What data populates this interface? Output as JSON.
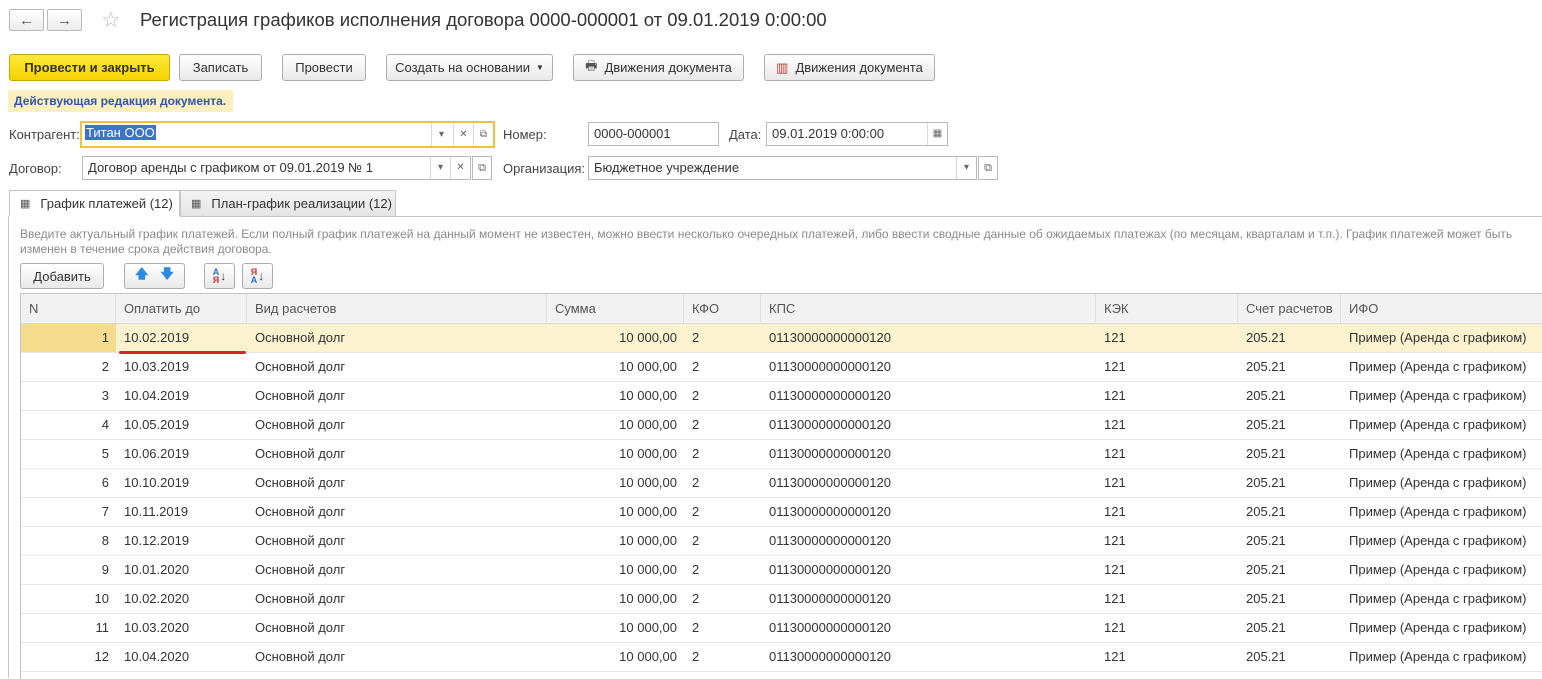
{
  "nav": {
    "back_icon": "←",
    "forward_icon": "→",
    "star_icon": "☆"
  },
  "window": {
    "title": "Регистрация графиков исполнения договора 0000-000001 от 09.01.2019 0:00:00"
  },
  "toolbar": {
    "post_close": "Провести и закрыть",
    "save": "Записать",
    "post": "Провести",
    "create_based": "Создать на основании",
    "movements_1": "Движения документа",
    "movements_2": "Движения документа"
  },
  "banner": "Действующая редакция документа.",
  "form": {
    "counterparty_label": "Контрагент:",
    "counterparty_value": "Титан ООО",
    "number_label": "Номер:",
    "number_value": "0000-000001",
    "date_label": "Дата:",
    "date_value": "09.01.2019  0:00:00",
    "contract_label": "Договор:",
    "contract_value": "Договор аренды с графиком от 09.01.2019 № 1",
    "org_label": "Организация:",
    "org_value": "Бюджетное учреждение"
  },
  "tabs": [
    {
      "label": "График платежей (12)"
    },
    {
      "label": "План-график реализации (12)"
    }
  ],
  "hint": "Введите актуальный график платежей. Если полный график платежей на данный момент не известен, можно ввести несколько очередных платежей, либо ввести сводные данные об ожидаемых платежах (по месяцам, кварталам и т.п.). График платежей может быть изменен в течение срока действия договора.",
  "subtoolbar": {
    "add": "Добавить"
  },
  "table": {
    "headers": [
      "N",
      "Оплатить до",
      "Вид расчетов",
      "Сумма",
      "КФО",
      "КПС",
      "КЭК",
      "Счет расчетов",
      "ИФО"
    ],
    "rows": [
      [
        "1",
        "10.02.2019",
        "Основной долг",
        "10 000,00",
        "2",
        "01130000000000120",
        "121",
        "205.21",
        "Пример (Аренда с графиком)"
      ],
      [
        "2",
        "10.03.2019",
        "Основной долг",
        "10 000,00",
        "2",
        "01130000000000120",
        "121",
        "205.21",
        "Пример (Аренда с графиком)"
      ],
      [
        "3",
        "10.04.2019",
        "Основной долг",
        "10 000,00",
        "2",
        "01130000000000120",
        "121",
        "205.21",
        "Пример (Аренда с графиком)"
      ],
      [
        "4",
        "10.05.2019",
        "Основной долг",
        "10 000,00",
        "2",
        "01130000000000120",
        "121",
        "205.21",
        "Пример (Аренда с графиком)"
      ],
      [
        "5",
        "10.06.2019",
        "Основной долг",
        "10 000,00",
        "2",
        "01130000000000120",
        "121",
        "205.21",
        "Пример (Аренда с графиком)"
      ],
      [
        "6",
        "10.10.2019",
        "Основной долг",
        "10 000,00",
        "2",
        "01130000000000120",
        "121",
        "205.21",
        "Пример (Аренда с графиком)"
      ],
      [
        "7",
        "10.11.2019",
        "Основной долг",
        "10 000,00",
        "2",
        "01130000000000120",
        "121",
        "205.21",
        "Пример (Аренда с графиком)"
      ],
      [
        "8",
        "10.12.2019",
        "Основной долг",
        "10 000,00",
        "2",
        "01130000000000120",
        "121",
        "205.21",
        "Пример (Аренда с графиком)"
      ],
      [
        "9",
        "10.01.2020",
        "Основной долг",
        "10 000,00",
        "2",
        "01130000000000120",
        "121",
        "205.21",
        "Пример (Аренда с графиком)"
      ],
      [
        "10",
        "10.02.2020",
        "Основной долг",
        "10 000,00",
        "2",
        "01130000000000120",
        "121",
        "205.21",
        "Пример (Аренда с графиком)"
      ],
      [
        "11",
        "10.03.2020",
        "Основной долг",
        "10 000,00",
        "2",
        "01130000000000120",
        "121",
        "205.21",
        "Пример (Аренда с графиком)"
      ],
      [
        "12",
        "10.04.2020",
        "Основной долг",
        "10 000,00",
        "2",
        "01130000000000120",
        "121",
        "205.21",
        "Пример (Аренда с графиком)"
      ]
    ]
  },
  "colors": {
    "primary_button": "#f5d300",
    "selected_row": "#fbf2d0",
    "annotation_line": "#d8232a"
  }
}
